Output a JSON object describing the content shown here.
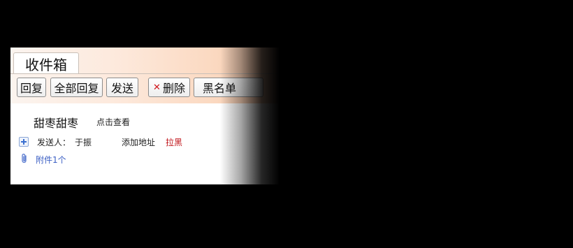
{
  "tab": {
    "label": "收件箱"
  },
  "toolbar": {
    "reply": "回复",
    "reply_all": "全部回复",
    "forward": "发送",
    "delete": "删除",
    "blacklist": "黑名单"
  },
  "message": {
    "subject": "甜枣甜枣",
    "view_link": "点击查看",
    "sender_label": "发送人：",
    "sender_name": "于振",
    "add_address": "添加地址",
    "block": "拉黑",
    "attachments": "附件1个"
  },
  "colors": {
    "delete_icon": "#d0141a",
    "block_link": "#c0141a",
    "attachment_link": "#3b5fc4"
  },
  "icons": {
    "delete": "close-x-icon",
    "expand_sender": "plus-square-icon",
    "attachment": "paperclip-icon"
  }
}
